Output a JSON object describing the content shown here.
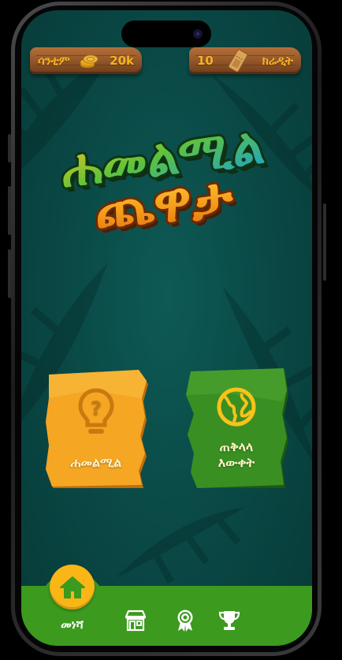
{
  "header": {
    "coins_label": "ሳንቲም",
    "coins_value": "20k",
    "coin_icon": "coin-stack-icon",
    "credits_value": "10",
    "credits_label": "ክሬዲት",
    "credit_icon": "ticket-icon"
  },
  "title": {
    "line1": "ሐመልሚል",
    "line2": "ጨዋታ"
  },
  "cards": [
    {
      "label": "ሐመልሚል",
      "icon": "lightbulb-question-icon",
      "color": "#f5a623"
    },
    {
      "label": "ጠቅላላ\nእውቀት",
      "icon": "globe-icon",
      "color": "#3a8f23"
    }
  ],
  "nav": {
    "items": [
      {
        "label": "መነሻ",
        "icon": "home-icon",
        "active": true
      },
      {
        "label": "",
        "icon": "store-icon",
        "active": false
      },
      {
        "label": "",
        "icon": "award-ribbon-icon",
        "active": false
      },
      {
        "label": "",
        "icon": "trophy-icon",
        "active": false
      }
    ]
  },
  "colors": {
    "background": "#0a4a47",
    "accent": "#f9b616",
    "nav": "#3c9a1e",
    "wood": "#8f5428"
  }
}
